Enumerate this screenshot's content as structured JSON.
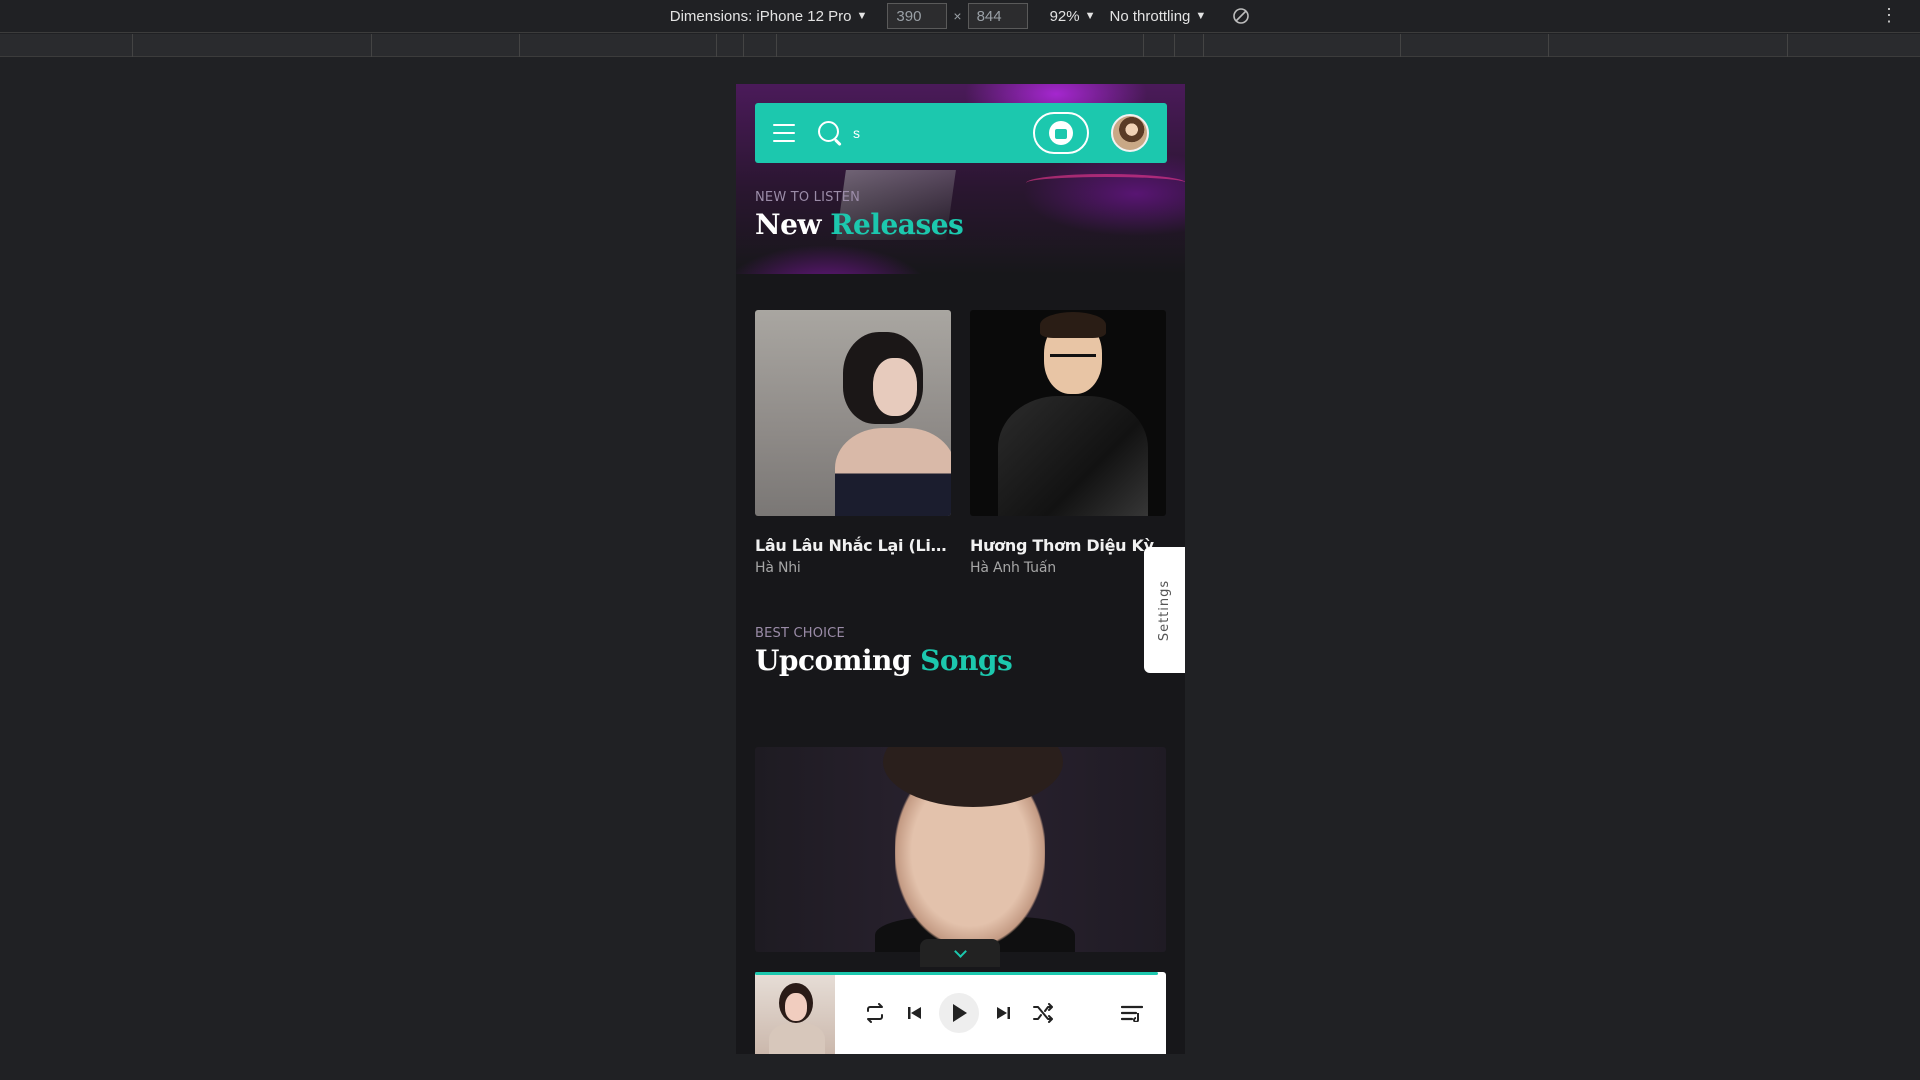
{
  "devtools": {
    "dimensions_label": "Dimensions: iPhone 12 Pro",
    "width_value": "390",
    "height_value": "844",
    "times": "×",
    "zoom": "92%",
    "throttling": "No throttling",
    "more": "⋮"
  },
  "app": {
    "search": {
      "value": "s"
    },
    "sections": {
      "new_releases": {
        "eyebrow": "NEW TO LISTEN",
        "title_main": "New",
        "title_accent": "Releases",
        "cards": [
          {
            "title": "Lâu Lâu Nhắc Lại (Live ...",
            "artist": "Hà Nhi"
          },
          {
            "title": "Hương Thơm Diệu Kỳ",
            "artist": "Hà Anh Tuấn"
          }
        ]
      },
      "upcoming": {
        "eyebrow": "BEST CHOICE",
        "title_main": "Upcoming",
        "title_accent": "Songs"
      }
    },
    "settings_tab": "Settings",
    "player": {
      "progress": 0.98
    },
    "colors": {
      "accent": "#1cc8ae",
      "background": "#17171a"
    }
  }
}
